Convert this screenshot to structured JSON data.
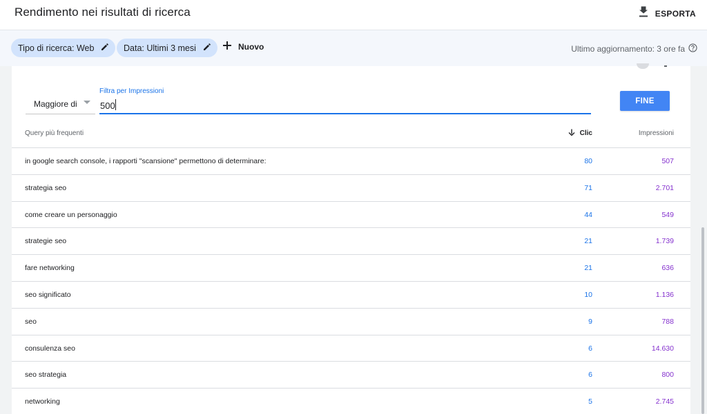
{
  "header": {
    "title": "Rendimento nei risultati di ricerca",
    "export_label": "ESPORTA"
  },
  "filters": {
    "search_type_chip": "Tipo di ricerca: Web",
    "date_chip": "Data: Ultimi 3 mesi",
    "new_label": "Nuovo",
    "last_update": "Ultimo aggiornamento: 3 ore fa"
  },
  "metric_filter": {
    "operator": "Maggiore di",
    "value_label": "Filtra per Impressioni",
    "value": "500",
    "done_label": "FINE"
  },
  "table": {
    "headers": {
      "query": "Query più frequenti",
      "clicks": "Clic",
      "impressions": "Impressioni"
    },
    "rows": [
      {
        "query": "in google search console, i rapporti \"scansione\" permettono di determinare:",
        "clicks": "80",
        "impressions": "507"
      },
      {
        "query": "strategia seo",
        "clicks": "71",
        "impressions": "2.701"
      },
      {
        "query": "come creare un personaggio",
        "clicks": "44",
        "impressions": "549"
      },
      {
        "query": "strategie seo",
        "clicks": "21",
        "impressions": "1.739"
      },
      {
        "query": "fare networking",
        "clicks": "21",
        "impressions": "636"
      },
      {
        "query": "seo significato",
        "clicks": "10",
        "impressions": "1.136"
      },
      {
        "query": "seo",
        "clicks": "9",
        "impressions": "788"
      },
      {
        "query": "consulenza seo",
        "clicks": "6",
        "impressions": "14.630"
      },
      {
        "query": "seo strategia",
        "clicks": "6",
        "impressions": "800"
      },
      {
        "query": "networking",
        "clicks": "5",
        "impressions": "2.745"
      }
    ]
  },
  "colors": {
    "accent_blue": "#1a73e8",
    "button_blue": "#4285f4",
    "impressions_purple": "#8430ce",
    "chip_bg": "#d2e3fc"
  },
  "icons": {
    "export": "download-icon",
    "edit": "pencil-icon",
    "add": "plus-icon",
    "help": "help-circle-icon",
    "sort": "arrow-down-icon"
  }
}
